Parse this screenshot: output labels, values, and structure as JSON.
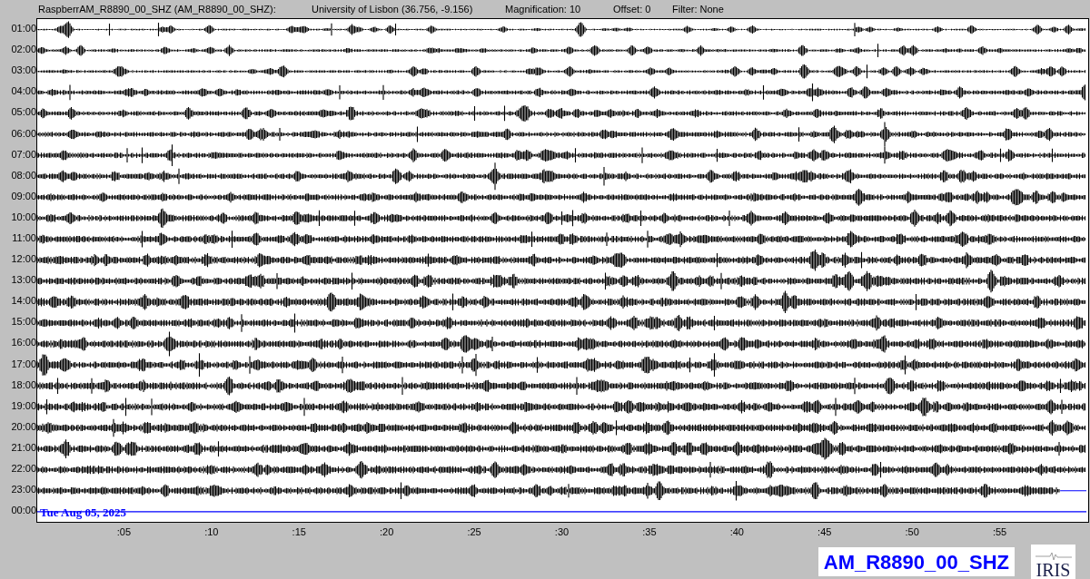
{
  "header": {
    "station": "RaspberrAM_R8890_00_SHZ (AM_R8890_00_SHZ):",
    "location": "University of Lisbon (36.756, -9.156)",
    "magnification": "Magnification: 10",
    "offset": "Offset: 0",
    "filter": "Filter: None"
  },
  "rows": [
    {
      "label": "01:00",
      "kind": "trace"
    },
    {
      "label": "02:00",
      "kind": "trace"
    },
    {
      "label": "03:00",
      "kind": "trace"
    },
    {
      "label": "04:00",
      "kind": "trace"
    },
    {
      "label": "05:00",
      "kind": "trace"
    },
    {
      "label": "06:00",
      "kind": "trace"
    },
    {
      "label": "07:00",
      "kind": "trace"
    },
    {
      "label": "08:00",
      "kind": "trace"
    },
    {
      "label": "09:00",
      "kind": "trace"
    },
    {
      "label": "10:00",
      "kind": "trace"
    },
    {
      "label": "11:00",
      "kind": "trace"
    },
    {
      "label": "12:00",
      "kind": "trace"
    },
    {
      "label": "13:00",
      "kind": "trace"
    },
    {
      "label": "14:00",
      "kind": "trace"
    },
    {
      "label": "15:00",
      "kind": "trace"
    },
    {
      "label": "16:00",
      "kind": "trace"
    },
    {
      "label": "17:00",
      "kind": "trace"
    },
    {
      "label": "18:00",
      "kind": "trace"
    },
    {
      "label": "19:00",
      "kind": "trace"
    },
    {
      "label": "20:00",
      "kind": "trace"
    },
    {
      "label": "21:00",
      "kind": "trace"
    },
    {
      "label": "22:00",
      "kind": "trace"
    },
    {
      "label": "23:00",
      "kind": "trace"
    },
    {
      "label": "00:00",
      "kind": "current"
    }
  ],
  "date_label": "Tue Aug 05, 2025",
  "minute_labels": [
    ":05",
    ":10",
    ":15",
    ":20",
    ":25",
    ":30",
    ":35",
    ":40",
    ":45",
    ":50",
    ":55"
  ],
  "channel_label": "AM_R8890_00_SHZ",
  "logo_text": "IRIS"
}
